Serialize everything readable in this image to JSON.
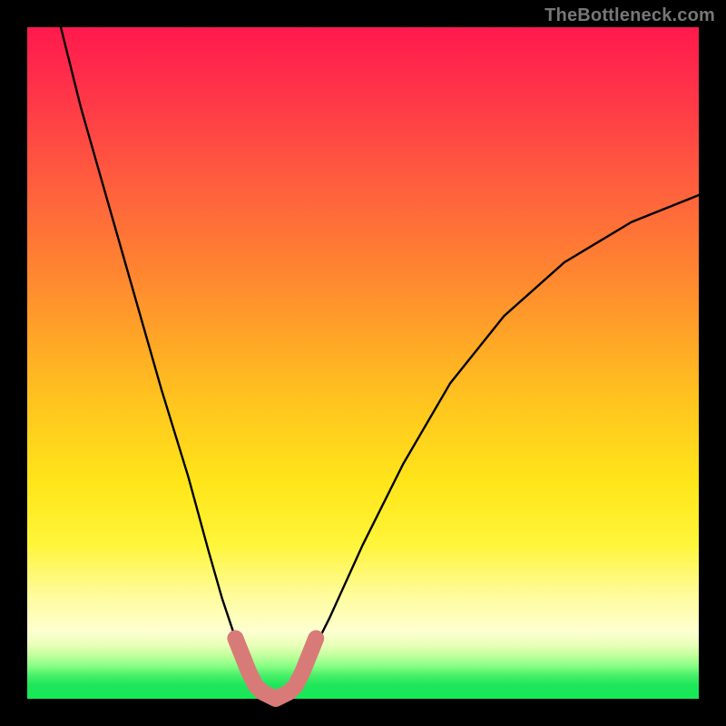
{
  "watermark": "TheBottleneck.com",
  "chart_data": {
    "type": "line",
    "title": "",
    "xlabel": "",
    "ylabel": "",
    "xlim": [
      0,
      100
    ],
    "ylim": [
      0,
      100
    ],
    "grid": false,
    "legend": false,
    "series": [
      {
        "name": "bottleneck-curve",
        "color": "#000000",
        "x": [
          5,
          8,
          12,
          16,
          20,
          24,
          27,
          29,
          31,
          33,
          35,
          37,
          39,
          41,
          45,
          50,
          56,
          63,
          71,
          80,
          90,
          100
        ],
        "y": [
          100,
          88,
          74,
          60,
          46,
          33,
          22,
          15,
          9,
          4,
          1,
          0,
          1,
          4,
          12,
          23,
          35,
          47,
          57,
          65,
          71,
          75
        ]
      }
    ],
    "markers": {
      "name": "highlight-band",
      "color": "#d87b78",
      "points": [
        {
          "x": 31,
          "y": 9
        },
        {
          "x": 33,
          "y": 4
        },
        {
          "x": 34,
          "y": 2
        },
        {
          "x": 35,
          "y": 1
        },
        {
          "x": 36,
          "y": 0.5
        },
        {
          "x": 37,
          "y": 0
        },
        {
          "x": 38,
          "y": 0.5
        },
        {
          "x": 39,
          "y": 1
        },
        {
          "x": 40,
          "y": 2
        },
        {
          "x": 41,
          "y": 4
        },
        {
          "x": 43,
          "y": 9
        }
      ]
    },
    "gradient_stops": [
      {
        "pos": 0,
        "color": "#ff1a4d"
      },
      {
        "pos": 55,
        "color": "#ffe61a"
      },
      {
        "pos": 90,
        "color": "#fdffd0"
      },
      {
        "pos": 100,
        "color": "#16e856"
      }
    ]
  }
}
